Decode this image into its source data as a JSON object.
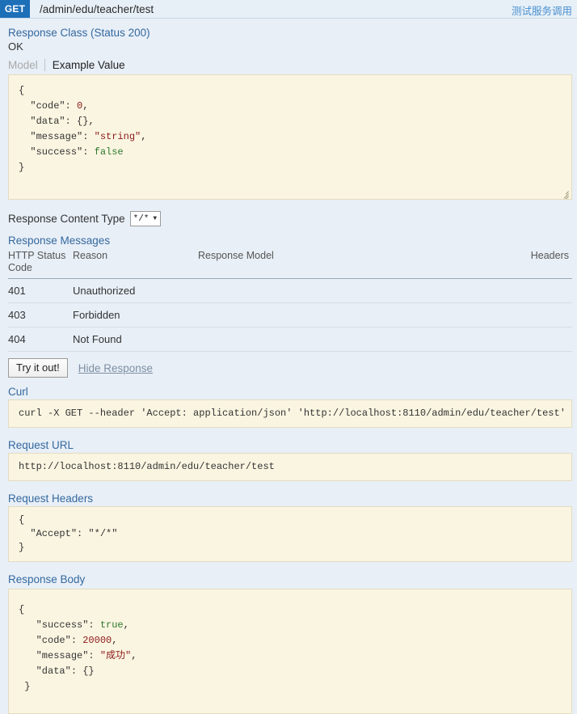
{
  "operation": {
    "method": "GET",
    "path": "/admin/edu/teacher/test",
    "summary": "测试服务调用"
  },
  "response_class": {
    "heading": "Response Class (Status 200)",
    "status_text": "OK",
    "tabs": [
      {
        "label": "Model",
        "active": false
      },
      {
        "label": "Example Value",
        "active": true
      }
    ],
    "example_value": {
      "open_brace": "{",
      "lines": [
        {
          "key": "\"code\"",
          "value": "0",
          "type": "num",
          "comma": ","
        },
        {
          "key": "\"data\"",
          "value": "{}",
          "type": "punct",
          "comma": ","
        },
        {
          "key": "\"message\"",
          "value": "\"string\"",
          "type": "str",
          "comma": ","
        },
        {
          "key": "\"success\"",
          "value": "false",
          "type": "bool",
          "comma": ""
        }
      ],
      "close_brace": "}"
    }
  },
  "content_type": {
    "label": "Response Content Type",
    "selected": "*/*",
    "caret": "▼"
  },
  "response_messages": {
    "heading": "Response Messages",
    "columns": [
      "HTTP Status Code",
      "Reason",
      "Response Model",
      "Headers"
    ],
    "rows": [
      {
        "code": "401",
        "reason": "Unauthorized",
        "model": "",
        "headers": ""
      },
      {
        "code": "403",
        "reason": "Forbidden",
        "model": "",
        "headers": ""
      },
      {
        "code": "404",
        "reason": "Not Found",
        "model": "",
        "headers": ""
      }
    ]
  },
  "actions": {
    "try_it_out": "Try it out!",
    "hide_response": "Hide Response"
  },
  "curl": {
    "heading": "Curl",
    "command": "curl -X GET --header 'Accept: application/json' 'http://localhost:8110/admin/edu/teacher/test'"
  },
  "request_url": {
    "heading": "Request URL",
    "url": "http://localhost:8110/admin/edu/teacher/test"
  },
  "request_headers": {
    "heading": "Request Headers",
    "open_brace": "{",
    "accept_key": "\"Accept\"",
    "accept_value": "\"*/*\"",
    "close_brace": "}"
  },
  "response_body": {
    "heading": "Response Body",
    "open_brace": "{",
    "lines": [
      {
        "key": "\"success\"",
        "value": "true",
        "type": "bool",
        "comma": ","
      },
      {
        "key": "\"code\"",
        "value": "20000",
        "type": "num",
        "comma": ","
      },
      {
        "key": "\"message\"",
        "value": "\"成功\"",
        "type": "str",
        "comma": ","
      },
      {
        "key": "\"data\"",
        "value": "{}",
        "type": "punct",
        "comma": ""
      }
    ],
    "close_brace": "}"
  },
  "colors": {
    "method_badge": "#1d6fb8",
    "heading_link": "#34689e",
    "summary_link": "#4a8fd0",
    "code_bg": "#faf5e1",
    "page_bg": "#e8eff7",
    "string_token": "#8b1a1a",
    "bool_token": "#2d7a2d"
  }
}
